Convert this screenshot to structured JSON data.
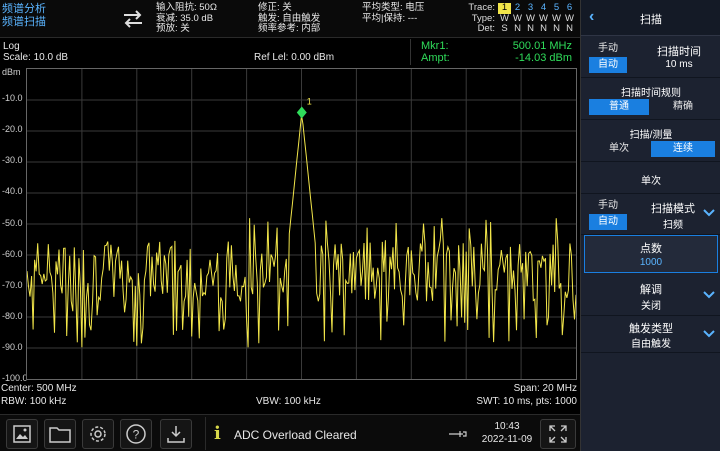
{
  "mode": {
    "line1": "频谱分析",
    "line2": "频谱扫描"
  },
  "status": {
    "col1": [
      "输入阻抗: 50Ω",
      "衰减: 35.0 dB",
      "预放: 关"
    ],
    "col2": [
      "修正: 关",
      "触发: 自由触发",
      "频率参考: 内部"
    ],
    "col3": [
      "平均类型: 电压",
      "平均|保持: ---"
    ]
  },
  "trace": {
    "labels": [
      "Trace:",
      "Type:",
      "Det:"
    ],
    "numbers": [
      "1",
      "2",
      "3",
      "4",
      "5",
      "6"
    ],
    "types": [
      "W",
      "W",
      "W",
      "W",
      "W",
      "W"
    ],
    "dets": [
      "S",
      "N",
      "N",
      "N",
      "N",
      "N"
    ]
  },
  "plot_header": {
    "scale_type": "Log",
    "scale": "Scale: 10.0 dB",
    "ref_level": "Ref Lel: 0.00 dBm",
    "unit": "dBm",
    "mkr_label": "Mkr1:",
    "mkr_freq": "500.01 MHz",
    "ampt_label": "Ampt:",
    "mkr_ampt": "-14.03 dBm",
    "marker_num": "1"
  },
  "y_labels": [
    "-10.0",
    "-20.0",
    "-30.0",
    "-40.0",
    "-50.0",
    "-60.0",
    "-70.0",
    "-80.0",
    "-90.0",
    "-100.0"
  ],
  "plot_footer": {
    "center": "Center: 500 MHz",
    "rbw": "RBW: 100 kHz",
    "vbw": "VBW: 100 kHz",
    "span": "Span: 20 MHz",
    "swt": "SWT: 10 ms, pts: 1000"
  },
  "message": "ADC Overload Cleared",
  "clock": {
    "time": "10:43",
    "date": "2022-11-09"
  },
  "panel": {
    "title": "扫描",
    "sweep_time": {
      "seg1": "手动",
      "seg2": "自动",
      "title": "扫描时间",
      "value": "10 ms"
    },
    "sweep_rule": {
      "title": "扫描时间规则",
      "opt1": "普通",
      "opt2": "精确"
    },
    "sweep_measure": {
      "title": "扫描/测量",
      "opt1": "单次",
      "opt2": "连续"
    },
    "single": "单次",
    "sweep_mode": {
      "seg1": "手动",
      "seg2": "自动",
      "title": "扫描模式",
      "value": "扫频"
    },
    "points": {
      "title": "点数",
      "value": "1000"
    },
    "demod": {
      "title": "解调",
      "value": "关闭"
    },
    "trigger": {
      "title": "触发类型",
      "value": "自由触发"
    }
  },
  "colors": {
    "trace": "#f2e64a",
    "marker": "#2fdc5a",
    "accent": "#1a7fe0",
    "panel": "#1c2230"
  },
  "chart_data": {
    "type": "line",
    "title": "",
    "xlabel": "",
    "ylabel": "",
    "x_range_mhz": [
      490,
      510
    ],
    "ylim": [
      -100,
      0
    ],
    "y_unit": "dBm",
    "noise_floor_dbm": -65,
    "noise_range_dbm": [
      -90,
      -48
    ],
    "series": [
      {
        "points": [
          [
            490,
            -62
          ],
          [
            492,
            -65
          ],
          [
            494,
            -64
          ],
          [
            496,
            -63
          ],
          [
            498,
            -66
          ],
          [
            499.5,
            -62
          ],
          [
            500.01,
            -14.03
          ],
          [
            500.5,
            -61
          ],
          [
            502,
            -64
          ],
          [
            504,
            -63
          ],
          [
            506,
            -65
          ],
          [
            508,
            -62
          ],
          [
            510,
            -64
          ]
        ]
      }
    ],
    "marker": {
      "label": "1",
      "x_mhz": 500.01,
      "y_dbm": -14.03
    },
    "grid": true,
    "points_count": 1000
  }
}
